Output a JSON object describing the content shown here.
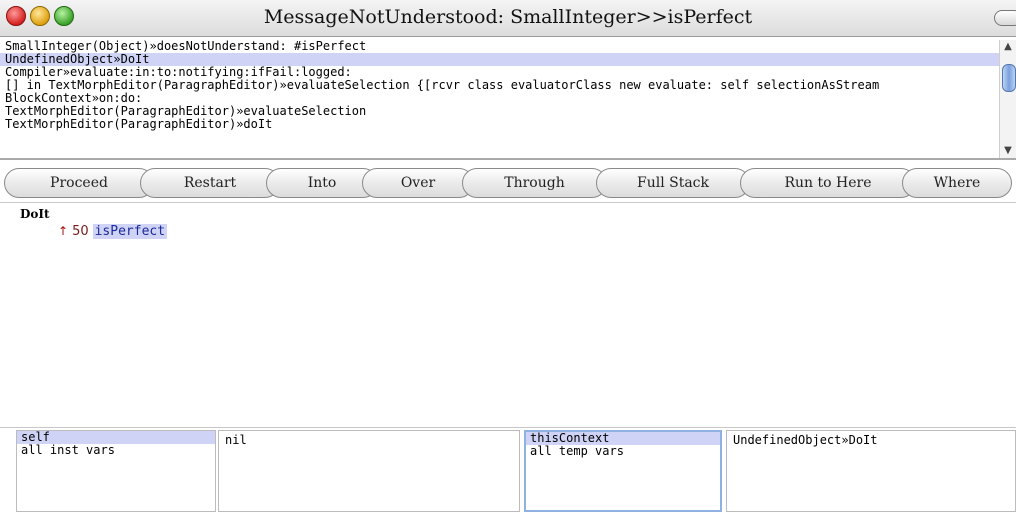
{
  "window": {
    "title": "MessageNotUnderstood: SmallInteger>>isPerfect"
  },
  "stack": {
    "selected_index": 1,
    "items": [
      "SmallInteger(Object)»doesNotUnderstand: #isPerfect",
      "UndefinedObject»DoIt",
      "Compiler»evaluate:in:to:notifying:ifFail:logged:",
      "[] in TextMorphEditor(ParagraphEditor)»evaluateSelection {[rcvr class evaluatorClass new   evaluate: self selectionAsStream",
      "BlockContext»on:do:",
      "TextMorphEditor(ParagraphEditor)»evaluateSelection",
      "TextMorphEditor(ParagraphEditor)»doIt"
    ]
  },
  "buttons": {
    "proceed": "Proceed",
    "restart": "Restart",
    "into": "Into",
    "over": "Over",
    "through": "Through",
    "full_stack": "Full Stack",
    "run_to_here": "Run to Here",
    "where": "Where"
  },
  "code": {
    "method": "DoIt",
    "caret": "↑",
    "number": "50",
    "selector": "isPerfect"
  },
  "inspectors": {
    "receiver_fields": [
      "self",
      "all inst vars"
    ],
    "receiver_value": "nil",
    "context_fields": [
      "thisContext",
      "all temp vars"
    ],
    "context_value": "UndefinedObject»DoIt"
  },
  "colors": {
    "selection": "#cfd3f5",
    "caret": "#a01010"
  }
}
